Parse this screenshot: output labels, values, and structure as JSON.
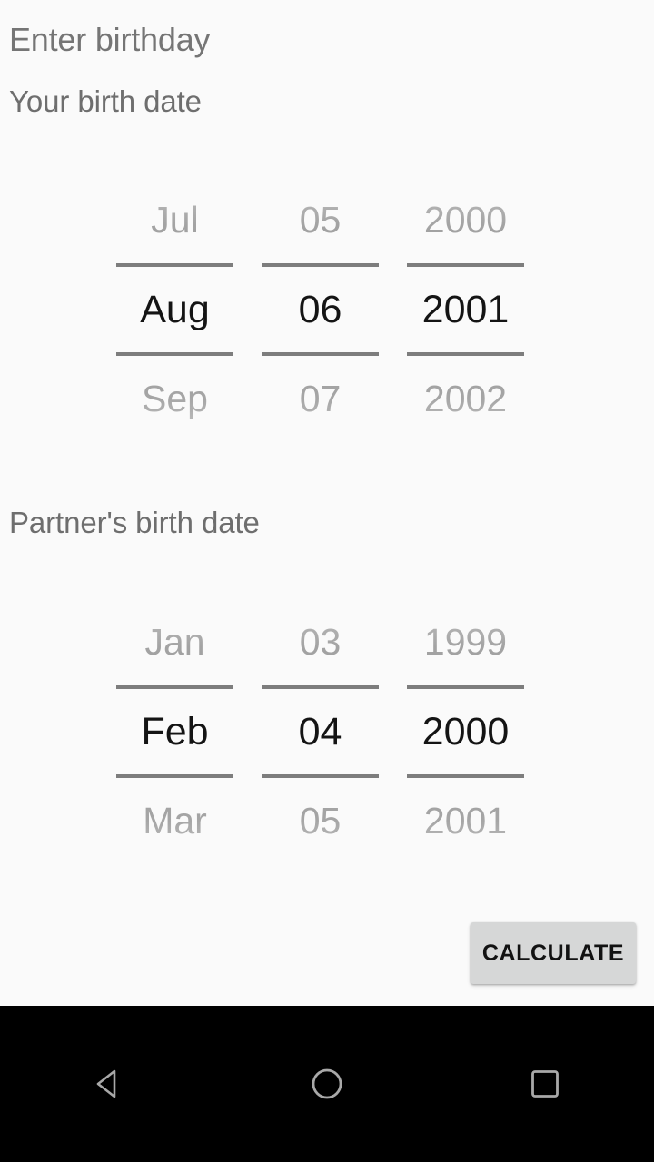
{
  "screen": {
    "title": "Enter birthday",
    "background_color": "#fafafa"
  },
  "sections": {
    "self": {
      "label": "Your birth date",
      "picker": {
        "month": {
          "prev": "Jul",
          "selected": "Aug",
          "next": "Sep"
        },
        "day": {
          "prev": "05",
          "selected": "06",
          "next": "07"
        },
        "year": {
          "prev": "2000",
          "selected": "2001",
          "next": "2002"
        }
      }
    },
    "partner": {
      "label": "Partner's birth date",
      "picker": {
        "month": {
          "prev": "Jan",
          "selected": "Feb",
          "next": "Mar"
        },
        "day": {
          "prev": "03",
          "selected": "04",
          "next": "05"
        },
        "year": {
          "prev": "1999",
          "selected": "2000",
          "next": "2001"
        }
      }
    }
  },
  "actions": {
    "calculate_label": "CALCULATE",
    "calculate_background": "#d6d7d7"
  },
  "navigation_bar": {
    "background_color": "#000000",
    "buttons": [
      {
        "name": "back-icon",
        "glyph": "triangle-left"
      },
      {
        "name": "home-icon",
        "glyph": "circle"
      },
      {
        "name": "recents-icon",
        "glyph": "square"
      }
    ]
  }
}
